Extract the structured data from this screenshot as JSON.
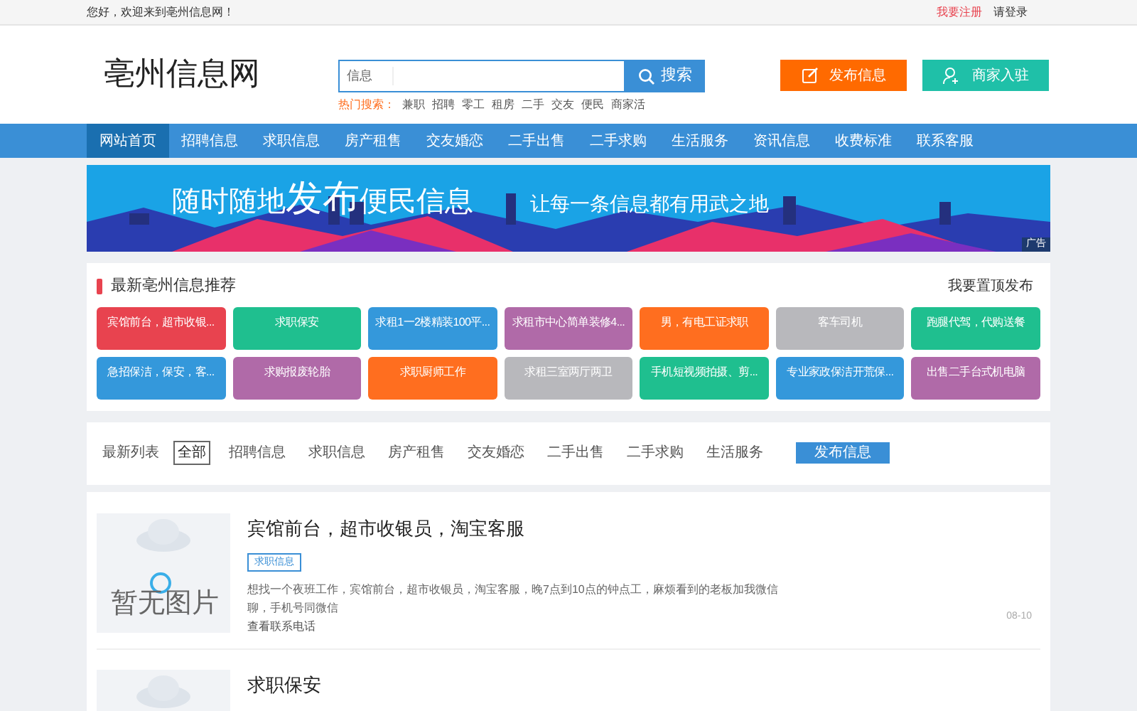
{
  "top_bar": {
    "greeting": "您好，欢迎来到亳州信息网！",
    "register": "我要注册",
    "login": "请登录"
  },
  "header": {
    "logo": "亳州信息网",
    "search": {
      "value": "信息",
      "button": "搜索"
    },
    "hot_label": "热门搜索：",
    "hot_terms": [
      "兼职",
      "招聘",
      "零工",
      "租房",
      "二手",
      "交友",
      "便民",
      "商家活"
    ],
    "post_button": "发布信息",
    "merchant_button": "商家入驻"
  },
  "nav": [
    {
      "label": "网站首页",
      "selected": true
    },
    {
      "label": "招聘信息",
      "selected": false
    },
    {
      "label": "求职信息",
      "selected": false
    },
    {
      "label": "房产租售",
      "selected": false
    },
    {
      "label": "交友婚恋",
      "selected": false
    },
    {
      "label": "二手出售",
      "selected": false
    },
    {
      "label": "二手求购",
      "selected": false
    },
    {
      "label": "生活服务",
      "selected": false
    },
    {
      "label": "资讯信息",
      "selected": false
    },
    {
      "label": "收费标准",
      "selected": false
    },
    {
      "label": "联系客服",
      "selected": false
    }
  ],
  "banner": {
    "headline_1": "随时随地",
    "headline_2": "发布",
    "headline_3": "便民信息",
    "slogan": "让每一条信息都有用武之地",
    "ad_label": "广告"
  },
  "recommend": {
    "title": "最新亳州信息推荐",
    "action": "我要置顶发布",
    "tiles": [
      {
        "label": "宾馆前台，超市收银...",
        "color": "#e8434f"
      },
      {
        "label": "求职保安",
        "color": "#1fbf8f"
      },
      {
        "label": "求租1一2楼精装100平...",
        "color": "#3498db"
      },
      {
        "label": "求租市中心简单装修4...",
        "color": "#b06aa8"
      },
      {
        "label": "男，有电工证求职",
        "color": "#ff6e1f"
      },
      {
        "label": "客车司机",
        "color": "#b8b8bc"
      },
      {
        "label": "跑腿代驾，代购送餐",
        "color": "#1fbf8f"
      },
      {
        "label": "急招保洁，保安，客...",
        "color": "#3498db"
      },
      {
        "label": "求购报废轮胎",
        "color": "#b06aa8"
      },
      {
        "label": "求职厨师工作",
        "color": "#ff6e1f"
      },
      {
        "label": "求租三室两厅两卫",
        "color": "#b8b8bc"
      },
      {
        "label": "手机短视频拍摄、剪...",
        "color": "#1fbf8f"
      },
      {
        "label": "专业家政保洁开荒保...",
        "color": "#3498db"
      },
      {
        "label": "出售二手台式机电脑",
        "color": "#b06aa8"
      }
    ]
  },
  "filter": {
    "label": "最新列表",
    "options": [
      {
        "label": "全部",
        "selected": true
      },
      {
        "label": "招聘信息",
        "selected": false
      },
      {
        "label": "求职信息",
        "selected": false
      },
      {
        "label": "房产租售",
        "selected": false
      },
      {
        "label": "交友婚恋",
        "selected": false
      },
      {
        "label": "二手出售",
        "selected": false
      },
      {
        "label": "二手求购",
        "selected": false
      },
      {
        "label": "生活服务",
        "selected": false
      }
    ],
    "post_button": "发布信息"
  },
  "listings": [
    {
      "image_text": "暂无图片",
      "title": "宾馆前台，超市收银员，淘宝客服",
      "tag": "求职信息",
      "description": "想找一个夜班工作，宾馆前台，超市收银员，淘宝客服，晚7点到10点的钟点工，麻烦看到的老板加我微信聊，手机号同微信",
      "contact": "查看联系电话",
      "date": "08-10"
    },
    {
      "title": "求职保安"
    }
  ]
}
